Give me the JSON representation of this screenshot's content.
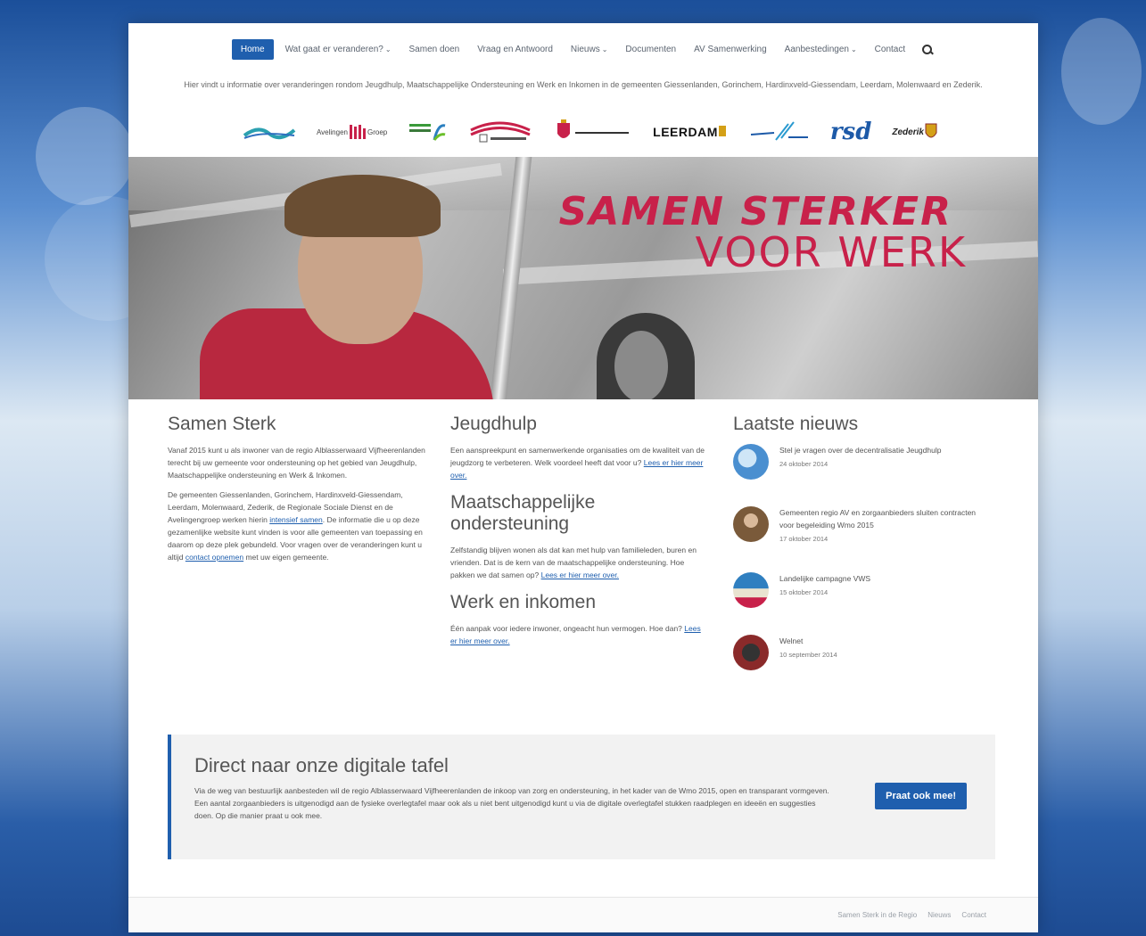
{
  "nav": {
    "items": [
      {
        "label": "Home",
        "active": true,
        "caret": false
      },
      {
        "label": "Wat gaat er veranderen?",
        "caret": true
      },
      {
        "label": "Samen doen",
        "caret": false
      },
      {
        "label": "Vraag en Antwoord",
        "caret": false
      },
      {
        "label": "Nieuws",
        "caret": true
      },
      {
        "label": "Documenten",
        "caret": false
      },
      {
        "label": "AV Samenwerking",
        "caret": false
      },
      {
        "label": "Aanbestedingen",
        "caret": true
      },
      {
        "label": "Contact",
        "caret": false
      }
    ],
    "search_icon": "search-icon"
  },
  "intro": "Hier vindt u informatie over veranderingen rondom Jeugdhulp, Maatschappelijke Ondersteuning en Werk en Inkomen in de gemeenten Giessenlanden, Gorinchem, Hardinxveld-Giessendam, Leerdam, Molenwaard en Zederik.",
  "logos": {
    "avelingen": "Avelingen",
    "groep": "Groep",
    "leerdam": "LEERDAM",
    "rsd": "rsd",
    "zederik": "Zederik"
  },
  "hero": {
    "title_line1": "SAMEN STERKER",
    "title_line2": "VOOR WERK"
  },
  "col1": {
    "title": "Samen Sterk",
    "p1": "Vanaf 2015 kunt u als inwoner van de regio Alblasserwaard Vijfheerenlanden terecht bij uw gemeente voor ondersteuning op het gebied van Jeugdhulp, Maatschappelijke ondersteuning en Werk & Inkomen.",
    "p2_a": "De gemeenten Giessenlanden, Gorinchem, Hardinxveld-Giessendam, Leerdam, Molenwaard, Zederik, de Regionale Sociale Dienst en de Avelingengroep werken hierin",
    "p2_link1": "intensief samen",
    "p2_b": ". De informatie die u op deze gezamenlijke website kunt vinden is voor alle gemeenten van toepassing en daarom op deze plek gebundeld. Voor vragen over de veranderingen kunt u altijd",
    "p2_link2": "contact opnemen",
    "p2_c": "met uw eigen gemeente."
  },
  "col2": {
    "jeugd_title": "Jeugdhulp",
    "jeugd_text": "Een aanspreekpunt en samenwerkende organisaties om de kwaliteit van de jeugdzorg te verbeteren. Welk voordeel heeft dat voor u?",
    "jeugd_link": "Lees er hier meer over.",
    "mo_title": "Maatschappelijke ondersteuning",
    "mo_text": "Zelfstandig blijven wonen als dat kan met hulp van familieleden, buren en vrienden. Dat is de kern van de maatschappelijke ondersteuning. Hoe pakken we dat samen op?",
    "mo_link": "Lees er hier meer over.",
    "werk_title": "Werk en inkomen",
    "werk_text": "Één aanpak voor iedere inwoner, ongeacht hun vermogen. Hoe dan?",
    "werk_link": "Lees er hier meer over."
  },
  "col3": {
    "title": "Laatste nieuws",
    "items": [
      {
        "title": "Stel je vragen over de decentralisatie Jeugdhulp",
        "date": "24 oktober 2014",
        "color": "#4a8fd0"
      },
      {
        "title": "Gemeenten regio AV en zorgaanbieders sluiten contracten voor begeleiding Wmo 2015",
        "date": "17 oktober 2014",
        "color": "#7a5a3a"
      },
      {
        "title": "Landelijke campagne VWS",
        "date": "15 oktober 2014",
        "color": "#2f7fc0"
      },
      {
        "title": "Welnet",
        "date": "10 september 2014",
        "color": "#8a2a2a"
      }
    ]
  },
  "cta": {
    "title": "Direct naar onze digitale tafel",
    "text": "Via de weg van bestuurlijk aanbesteden wil de regio Alblasserwaard Vijfheerenlanden de inkoop van zorg en ondersteuning, in het kader van de Wmo 2015, open en transparant vormgeven. Een aantal zorgaanbieders is uitgenodigd aan de fysieke overlegtafel maar ook als u niet bent uitgenodigd kunt u via de digitale overlegtafel stukken raadplegen en ideeën en suggesties doen. Op die manier praat u ook mee.",
    "button": "Praat ook mee!"
  },
  "footer": {
    "links": [
      "Samen Sterk in de Regio",
      "Nieuws",
      "Contact"
    ]
  }
}
